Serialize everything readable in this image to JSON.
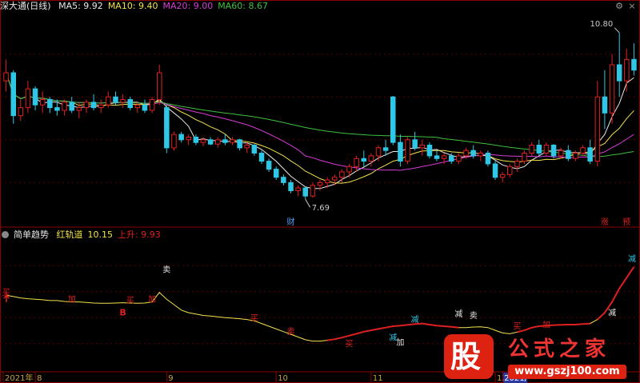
{
  "header": {
    "symbol": "深大通(日线)",
    "ma": [
      {
        "label": "MA5: 9.92",
        "color": "#e8e8e8"
      },
      {
        "label": "MA10: 9.40",
        "color": "#f2e14b"
      },
      {
        "label": "MA20: 9.00",
        "color": "#d63cd6"
      },
      {
        "label": "MA60: 8.67",
        "color": "#3fbf3f"
      }
    ]
  },
  "indicator_header": {
    "name": "简单趋势",
    "series": [
      {
        "label": "红轨道",
        "color": "#f2e14b"
      },
      {
        "label": "10.15",
        "color": "#f2e14b"
      },
      {
        "label": "上升: 9.93",
        "color": "#e02020"
      }
    ]
  },
  "colors": {
    "up": "#e02020",
    "down": "#2ec8e6",
    "grid": "#5a0000",
    "frame": "#8b0000"
  },
  "chart_data": [
    {
      "type": "candlestick",
      "title": "深大通(日线)",
      "ylim": [
        7.2,
        11.2
      ],
      "ohlc": [
        [
          9.9,
          10.3,
          9.7,
          10.05
        ],
        [
          10.05,
          10.1,
          9.1,
          9.25
        ],
        [
          9.25,
          9.55,
          9.15,
          9.4
        ],
        [
          9.4,
          9.9,
          9.3,
          9.75
        ],
        [
          9.75,
          9.8,
          9.35,
          9.45
        ],
        [
          9.45,
          9.7,
          9.3,
          9.55
        ],
        [
          9.55,
          9.6,
          9.3,
          9.4
        ],
        [
          9.4,
          9.55,
          9.25,
          9.35
        ],
        [
          9.35,
          9.55,
          9.25,
          9.5
        ],
        [
          9.5,
          9.6,
          9.3,
          9.35
        ],
        [
          9.35,
          9.5,
          9.2,
          9.4
        ],
        [
          9.4,
          9.55,
          9.3,
          9.5
        ],
        [
          9.5,
          9.65,
          9.35,
          9.4
        ],
        [
          9.4,
          9.55,
          9.3,
          9.45
        ],
        [
          9.45,
          9.7,
          9.4,
          9.6
        ],
        [
          9.6,
          9.7,
          9.45,
          9.5
        ],
        [
          9.5,
          9.65,
          9.4,
          9.55
        ],
        [
          9.55,
          9.6,
          9.35,
          9.4
        ],
        [
          9.4,
          9.5,
          9.3,
          9.45
        ],
        [
          9.45,
          9.55,
          9.3,
          9.35
        ],
        [
          9.35,
          9.6,
          9.3,
          9.55
        ],
        [
          9.55,
          10.2,
          9.45,
          10.05
        ],
        [
          9.4,
          9.45,
          8.55,
          8.65
        ],
        [
          8.65,
          8.95,
          8.6,
          8.9
        ],
        [
          8.9,
          8.95,
          8.75,
          8.8
        ],
        [
          8.8,
          8.9,
          8.7,
          8.85
        ],
        [
          8.85,
          8.9,
          8.7,
          8.75
        ],
        [
          8.75,
          8.85,
          8.68,
          8.8
        ],
        [
          8.8,
          8.85,
          8.7,
          8.72
        ],
        [
          8.72,
          8.85,
          8.65,
          8.8
        ],
        [
          8.8,
          8.9,
          8.7,
          8.75
        ],
        [
          8.75,
          8.85,
          8.7,
          8.8
        ],
        [
          8.8,
          8.82,
          8.6,
          8.65
        ],
        [
          8.65,
          8.75,
          8.55,
          8.7
        ],
        [
          8.7,
          8.72,
          8.5,
          8.55
        ],
        [
          8.55,
          8.6,
          8.35,
          8.4
        ],
        [
          8.4,
          8.45,
          8.2,
          8.25
        ],
        [
          8.25,
          8.3,
          8.05,
          8.1
        ],
        [
          8.1,
          8.15,
          7.95,
          8.0
        ],
        [
          8.0,
          8.05,
          7.8,
          7.85
        ],
        [
          7.85,
          7.95,
          7.75,
          7.9
        ],
        [
          7.9,
          7.92,
          7.69,
          7.75
        ],
        [
          7.75,
          8.0,
          7.72,
          7.95
        ],
        [
          7.95,
          8.05,
          7.85,
          8.0
        ],
        [
          8.0,
          8.1,
          7.9,
          8.05
        ],
        [
          8.05,
          8.15,
          7.95,
          8.1
        ],
        [
          8.1,
          8.25,
          8.0,
          8.2
        ],
        [
          8.2,
          8.35,
          8.1,
          8.3
        ],
        [
          8.3,
          8.5,
          8.2,
          8.45
        ],
        [
          8.45,
          8.6,
          8.3,
          8.4
        ],
        [
          8.4,
          8.55,
          8.3,
          8.5
        ],
        [
          8.5,
          8.7,
          8.4,
          8.65
        ],
        [
          8.65,
          8.8,
          8.5,
          8.6
        ],
        [
          9.6,
          9.62,
          8.7,
          8.75
        ],
        [
          8.75,
          8.9,
          8.3,
          8.4
        ],
        [
          8.4,
          8.85,
          8.35,
          8.8
        ],
        [
          8.8,
          8.95,
          8.6,
          8.65
        ],
        [
          8.65,
          8.8,
          8.5,
          8.7
        ],
        [
          8.7,
          8.75,
          8.45,
          8.5
        ],
        [
          8.5,
          8.6,
          8.4,
          8.45
        ],
        [
          8.45,
          8.55,
          8.35,
          8.5
        ],
        [
          8.5,
          8.55,
          8.35,
          8.4
        ],
        [
          8.4,
          8.55,
          8.35,
          8.5
        ],
        [
          8.5,
          8.65,
          8.45,
          8.6
        ],
        [
          8.6,
          8.7,
          8.45,
          8.5
        ],
        [
          8.5,
          8.6,
          8.4,
          8.55
        ],
        [
          8.55,
          8.6,
          8.3,
          8.35
        ],
        [
          8.35,
          8.4,
          8.05,
          8.1
        ],
        [
          8.1,
          8.2,
          8.0,
          8.15
        ],
        [
          8.15,
          8.35,
          8.1,
          8.3
        ],
        [
          8.3,
          8.45,
          8.2,
          8.4
        ],
        [
          8.4,
          8.6,
          8.35,
          8.55
        ],
        [
          8.55,
          8.75,
          8.5,
          8.7
        ],
        [
          8.7,
          8.8,
          8.5,
          8.55
        ],
        [
          8.55,
          8.75,
          8.5,
          8.7
        ],
        [
          8.7,
          8.72,
          8.45,
          8.5
        ],
        [
          8.5,
          8.65,
          8.45,
          8.6
        ],
        [
          8.6,
          8.7,
          8.4,
          8.45
        ],
        [
          8.45,
          8.6,
          8.4,
          8.55
        ],
        [
          8.55,
          8.7,
          8.5,
          8.65
        ],
        [
          8.65,
          8.8,
          8.35,
          8.4
        ],
        [
          8.4,
          9.9,
          8.3,
          9.6
        ],
        [
          9.6,
          10.1,
          9.0,
          9.3
        ],
        [
          9.3,
          10.4,
          9.1,
          10.2
        ],
        [
          10.2,
          10.8,
          9.6,
          9.9
        ],
        [
          9.9,
          10.5,
          9.7,
          10.3
        ],
        [
          10.3,
          10.6,
          10.0,
          10.1
        ]
      ],
      "ma": [
        {
          "name": "MA5",
          "color": "#e8e8e8"
        },
        {
          "name": "MA10",
          "color": "#f2e14b"
        },
        {
          "name": "MA20",
          "color": "#d63cd6"
        },
        {
          "name": "MA60",
          "color": "#3fbf3f"
        }
      ],
      "annotations": [
        {
          "text": "7.69",
          "index": 41,
          "value": 7.69
        },
        {
          "text": "10.80",
          "index": 84,
          "value": 10.8
        },
        {
          "text": "财",
          "index": 39,
          "at": "bottom"
        },
        {
          "text": "涨",
          "index": 82,
          "at": "bottom"
        },
        {
          "text": "预",
          "index": 85,
          "at": "bottom"
        }
      ]
    },
    {
      "type": "line",
      "title": "简单趋势",
      "series": [
        {
          "name": "红轨道",
          "color": "#f2e14b"
        },
        {
          "name": "上升",
          "color": "#e02020"
        }
      ],
      "ylim": [
        7.0,
        11.8
      ],
      "values": [
        9.75,
        9.7,
        9.65,
        9.62,
        9.6,
        9.58,
        9.55,
        9.55,
        9.52,
        9.5,
        9.5,
        9.48,
        9.46,
        9.45,
        9.45,
        9.46,
        9.47,
        9.46,
        9.45,
        9.46,
        9.5,
        9.85,
        9.6,
        9.4,
        9.2,
        9.1,
        9.05,
        9.0,
        8.98,
        8.95,
        8.92,
        8.9,
        8.88,
        8.85,
        8.8,
        8.7,
        8.6,
        8.5,
        8.4,
        8.3,
        8.2,
        8.1,
        8.05,
        8.05,
        8.08,
        8.12,
        8.18,
        8.25,
        8.32,
        8.4,
        8.45,
        8.5,
        8.55,
        8.6,
        8.62,
        8.65,
        8.68,
        8.7,
        8.66,
        8.62,
        8.6,
        8.58,
        8.55,
        8.55,
        8.57,
        8.58,
        8.55,
        8.45,
        8.35,
        8.32,
        8.38,
        8.45,
        8.55,
        8.6,
        8.62,
        8.64,
        8.65,
        8.66,
        8.66,
        8.68,
        8.7,
        8.85,
        9.1,
        9.5,
        10.0,
        10.4,
        10.8
      ],
      "rising_ranges": [
        [
          44,
          62
        ],
        [
          70,
          80
        ],
        [
          81,
          86
        ]
      ],
      "markers": [
        {
          "text": "买",
          "index": 0,
          "value": 9.75,
          "color": "#e02020"
        },
        {
          "text": "加",
          "index": 9,
          "value": 9.5,
          "color": "#e02020"
        },
        {
          "text": "B",
          "index": 16,
          "value": 9.0,
          "color": "#e02020"
        },
        {
          "text": "买",
          "index": 17,
          "value": 9.46,
          "color": "#e02020"
        },
        {
          "text": "加",
          "index": 20,
          "value": 9.5,
          "color": "#e02020"
        },
        {
          "text": "卖",
          "index": 22,
          "value": 10.6,
          "color": "#e8e8e8"
        },
        {
          "text": "买",
          "index": 34,
          "value": 8.8,
          "color": "#e02020"
        },
        {
          "text": "卖",
          "index": 39,
          "value": 8.3,
          "color": "#e02020"
        },
        {
          "text": "买",
          "index": 47,
          "value": 7.85,
          "color": "#e02020"
        },
        {
          "text": "减",
          "index": 53,
          "value": 8.08,
          "color": "#2ec8e6"
        },
        {
          "text": "加",
          "index": 54,
          "value": 7.9,
          "color": "#e8e8e8"
        },
        {
          "text": "减",
          "index": 56,
          "value": 8.75,
          "color": "#2ec8e6"
        },
        {
          "text": "减",
          "index": 62,
          "value": 8.95,
          "color": "#e8e8e8"
        },
        {
          "text": "卖",
          "index": 64,
          "value": 8.9,
          "color": "#e8e8e8"
        },
        {
          "text": "B",
          "index": 64,
          "value": 7.95,
          "color": "#e02020"
        },
        {
          "text": "买",
          "index": 70,
          "value": 8.5,
          "color": "#e02020"
        },
        {
          "text": "加",
          "index": 74,
          "value": 8.55,
          "color": "#e02020"
        },
        {
          "text": "减",
          "index": 83,
          "value": 9.0,
          "color": "#e8e8e8"
        },
        {
          "text": "减",
          "index": 94,
          "value": 11.0,
          "color": "#2ec8e6"
        }
      ]
    }
  ],
  "xaxis": {
    "labels": [
      {
        "text": "2021年",
        "index": 0
      },
      {
        "text": "8",
        "index": 4
      },
      {
        "text": "9",
        "index": 22
      },
      {
        "text": "10",
        "index": 37
      },
      {
        "text": "11",
        "index": 50
      },
      {
        "text": "12",
        "index": 67
      },
      {
        "text": "2021/",
        "index": 68
      }
    ]
  },
  "watermark": {
    "logo_char": "股",
    "title": "公式之家",
    "url": "www.gszj100.com"
  }
}
